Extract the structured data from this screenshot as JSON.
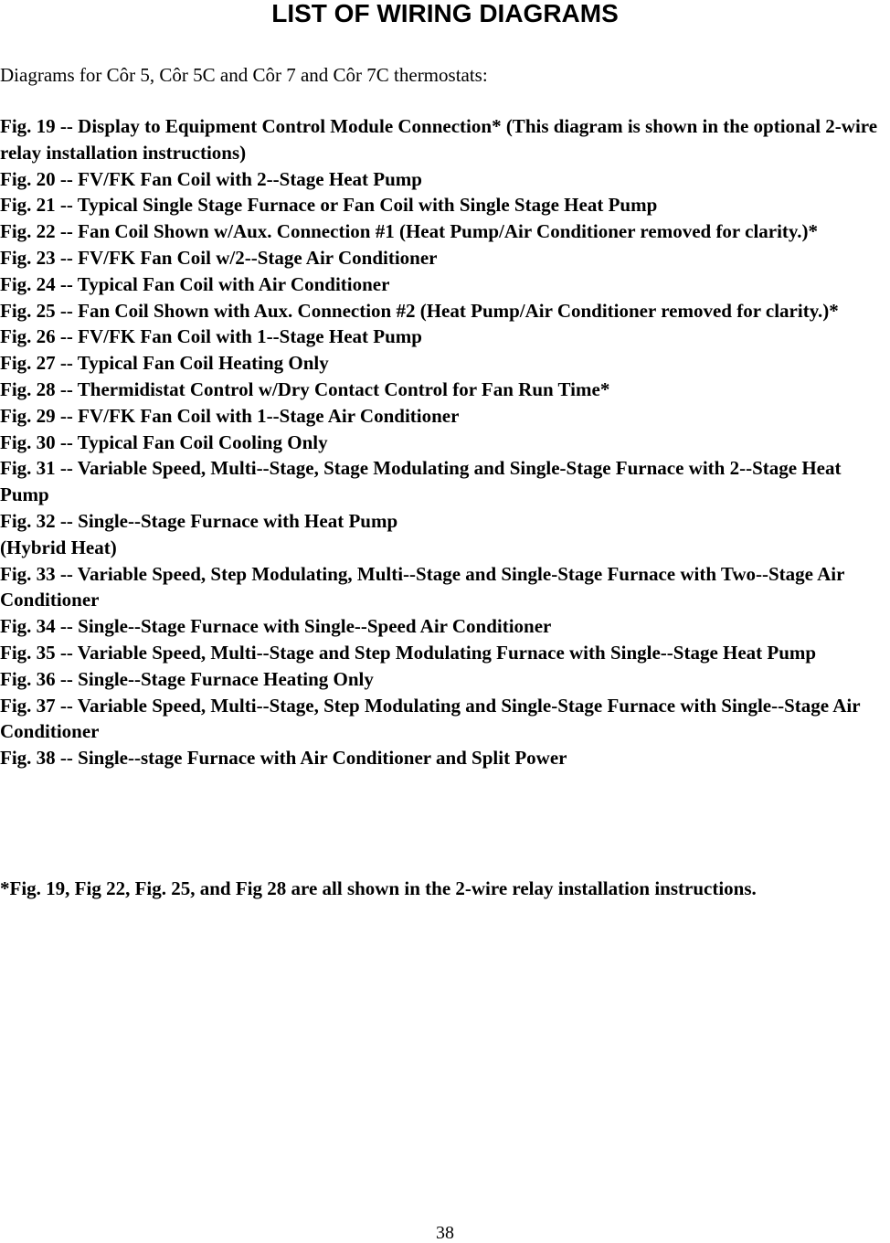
{
  "page": {
    "title": "LIST OF WIRING DIAGRAMS",
    "intro": "Diagrams for Côr 5, Côr 5C and Côr 7 and Côr 7C thermostats:",
    "figures": [
      "Fig. 19 -- Display to Equipment Control Module Connection* (This diagram is shown in the optional 2-wire relay installation instructions)",
      "Fig. 20 -- FV/FK Fan Coil with 2--Stage Heat Pump",
      "Fig. 21 -- Typical Single Stage Furnace or Fan Coil with Single Stage Heat Pump",
      "Fig. 22 -- Fan Coil Shown w/Aux. Connection #1 (Heat Pump/Air Conditioner removed for clarity.)*",
      "Fig. 23 -- FV/FK Fan Coil w/2--Stage Air Conditioner",
      "Fig. 24 -- Typical Fan Coil with Air Conditioner",
      "Fig. 25 -- Fan Coil Shown with Aux. Connection #2 (Heat Pump/Air Conditioner removed for clarity.)*",
      "Fig. 26 -- FV/FK Fan Coil with 1--Stage Heat Pump",
      "Fig. 27 -- Typical Fan Coil Heating Only",
      "Fig. 28 -- Thermidistat Control w/Dry Contact Control for Fan Run Time*",
      "Fig. 29 -- FV/FK Fan Coil with 1--Stage Air Conditioner",
      "Fig. 30 -- Typical Fan Coil Cooling Only",
      "Fig. 31 -- Variable Speed, Multi--Stage, Stage Modulating and Single-Stage Furnace with 2--Stage Heat Pump",
      "Fig. 32 -- Single--Stage Furnace with Heat Pump\n(Hybrid Heat)",
      "Fig. 33 -- Variable Speed, Step Modulating, Multi--Stage and Single-Stage Furnace with Two--Stage Air Conditioner",
      "Fig. 34 -- Single--Stage Furnace with Single--Speed Air Conditioner",
      "Fig. 35 -- Variable Speed, Multi--Stage and Step Modulating Furnace with Single--Stage Heat Pump",
      "Fig. 36 -- Single--Stage Furnace Heating Only",
      "Fig. 37 -- Variable Speed, Multi--Stage, Step Modulating and Single-Stage Furnace with Single--Stage Air Conditioner",
      "Fig. 38 -- Single--stage Furnace with Air Conditioner and Split Power"
    ],
    "footnote": "*Fig. 19, Fig 22, Fig. 25, and Fig 28 are all shown in the 2-wire relay installation instructions.",
    "page_number": "38"
  }
}
